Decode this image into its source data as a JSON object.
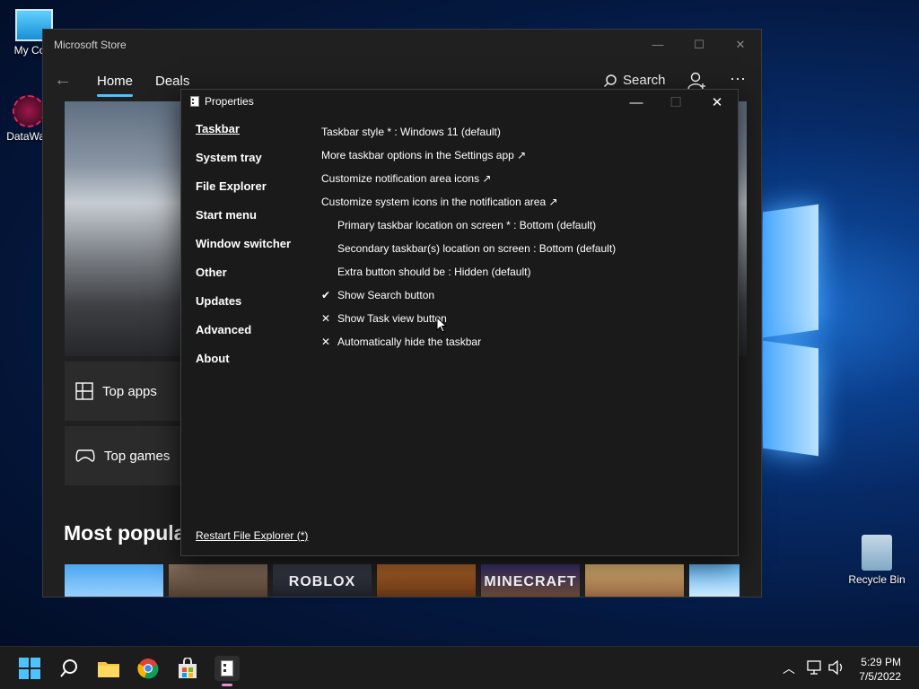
{
  "desktop": {
    "icons": [
      {
        "label": "My Com"
      },
      {
        "label": "DataWag"
      },
      {
        "label": "Recycle Bin"
      }
    ]
  },
  "store": {
    "title": "Microsoft Store",
    "controls": {
      "minimize": "—",
      "maximize": "☐",
      "close": "✕"
    },
    "tabs": [
      "Home",
      "Deals"
    ],
    "search_label": "Search",
    "more": "···",
    "cards": [
      "Top apps",
      "Top games"
    ],
    "section_title": "Most popula",
    "tiles": [
      "",
      "",
      "ROBLOX",
      "",
      "MINECRAFT",
      "",
      ""
    ]
  },
  "properties": {
    "title": "Properties",
    "controls": {
      "minimize": "—",
      "maximize": "☐",
      "close": "✕"
    },
    "sidebar": [
      "Taskbar",
      "System tray",
      "File Explorer",
      "Start menu",
      "Window switcher",
      "Other",
      "Updates",
      "Advanced",
      "About"
    ],
    "rows": [
      {
        "text": "Taskbar style * : Windows 11 (default)",
        "mark": "",
        "indent": false
      },
      {
        "text": "More taskbar options in the Settings app ↗",
        "mark": "",
        "indent": false
      },
      {
        "text": "Customize notification area icons ↗",
        "mark": "",
        "indent": false
      },
      {
        "text": "Customize system icons in the notification area ↗",
        "mark": "",
        "indent": false
      },
      {
        "text": "Primary taskbar location on screen * : Bottom (default)",
        "mark": "",
        "indent": true
      },
      {
        "text": "Secondary taskbar(s) location on screen : Bottom (default)",
        "mark": "",
        "indent": true
      },
      {
        "text": "Extra button should be : Hidden (default)",
        "mark": "",
        "indent": true
      },
      {
        "text": "Show Search button",
        "mark": "✔",
        "indent": false
      },
      {
        "text": "Show Task view button",
        "mark": "✕",
        "indent": false
      },
      {
        "text": "Automatically hide the taskbar",
        "mark": "✕",
        "indent": false
      }
    ],
    "restart_link": "Restart File Explorer (*)"
  },
  "taskbar": {
    "time": "5:29 PM",
    "date": "7/5/2022",
    "accent": "#4cc2ff"
  }
}
